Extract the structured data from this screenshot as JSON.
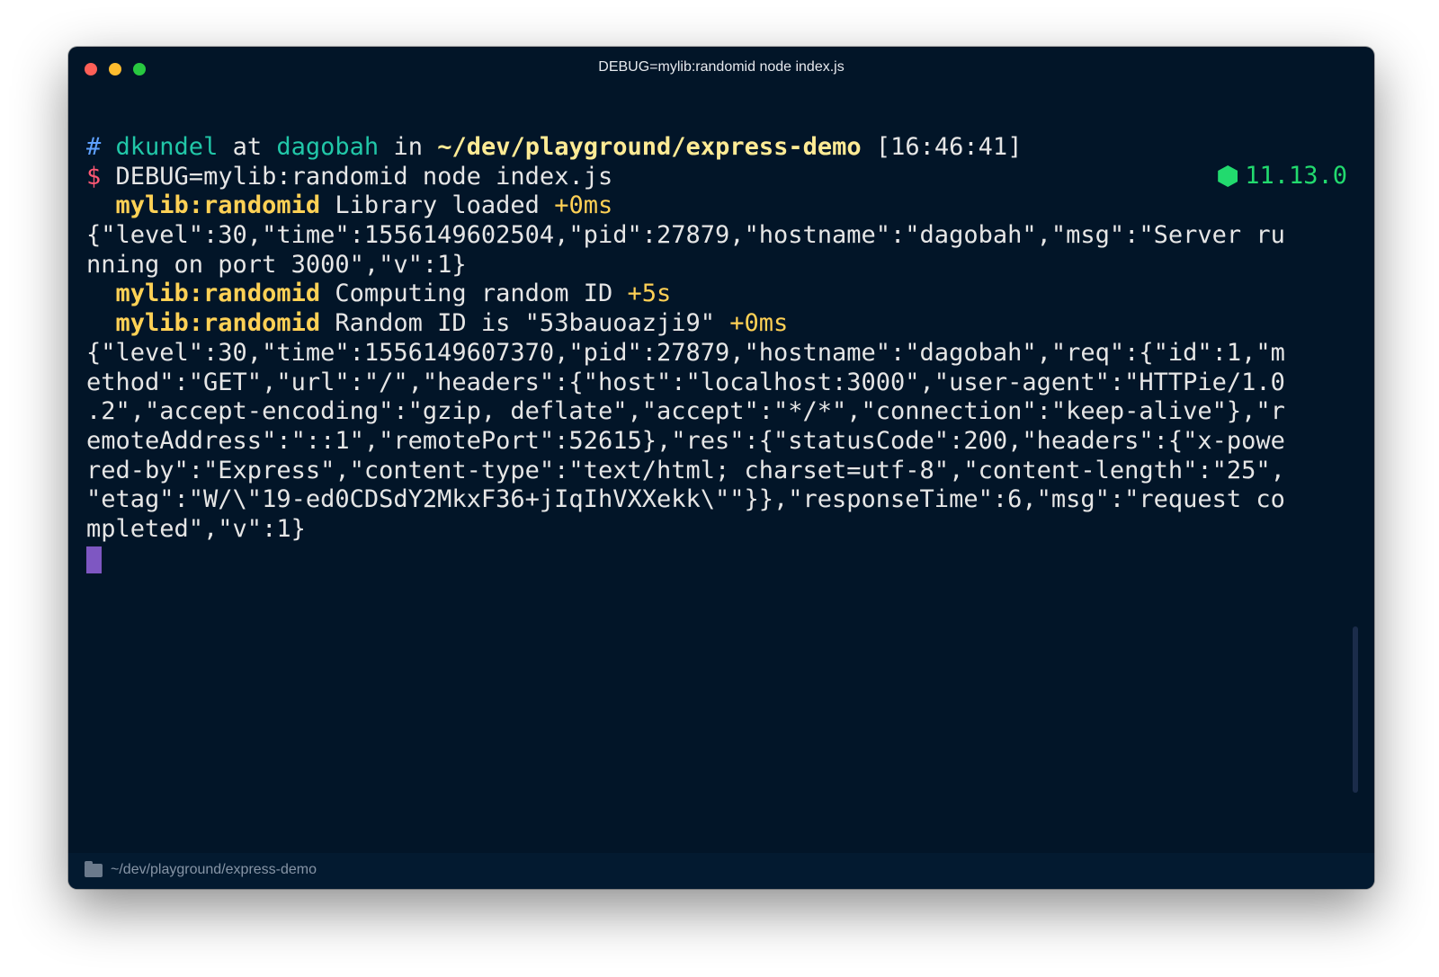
{
  "window": {
    "title": "DEBUG=mylib:randomid node index.js"
  },
  "prompt": {
    "hash": "#",
    "user": "dkundel",
    "at": "at",
    "host": "dagobah",
    "in": "in",
    "path": "~/dev/playground/express-demo",
    "time": "[16:46:41]",
    "dollar": "$",
    "command": "DEBUG=mylib:randomid node index.js",
    "node_version": "11.13.0"
  },
  "output": {
    "debug1": {
      "namespace": "mylib:randomid",
      "message": "Library loaded",
      "delta": "+0ms"
    },
    "log1": [
      "{\"level\":30,\"time\":1556149602504,\"pid\":27879,\"hostname\":\"dagobah\",\"msg\":\"Server ru",
      "nning on port 3000\",\"v\":1}"
    ],
    "debug2": {
      "namespace": "mylib:randomid",
      "message": "Computing random ID",
      "delta": "+5s"
    },
    "debug3": {
      "namespace": "mylib:randomid",
      "message": "Random ID is \"53bauoazji9\"",
      "delta": "+0ms"
    },
    "log2": [
      "{\"level\":30,\"time\":1556149607370,\"pid\":27879,\"hostname\":\"dagobah\",\"req\":{\"id\":1,\"m",
      "ethod\":\"GET\",\"url\":\"/\",\"headers\":{\"host\":\"localhost:3000\",\"user-agent\":\"HTTPie/1.0",
      ".2\",\"accept-encoding\":\"gzip, deflate\",\"accept\":\"*/*\",\"connection\":\"keep-alive\"},\"r",
      "emoteAddress\":\"::1\",\"remotePort\":52615},\"res\":{\"statusCode\":200,\"headers\":{\"x-powe",
      "red-by\":\"Express\",\"content-type\":\"text/html; charset=utf-8\",\"content-length\":\"25\",",
      "\"etag\":\"W/\\\"19-ed0CDSdY2MkxF36+jIqIhVXXekk\\\"\"}},\"responseTime\":6,\"msg\":\"request co",
      "mpleted\",\"v\":1}"
    ]
  },
  "statusbar": {
    "path": "~/dev/playground/express-demo"
  },
  "colors": {
    "background": "#021528",
    "hash": "#5ea1ff",
    "user_host": "#21c7a8",
    "path": "#ffeb95",
    "dollar": "#ff5874",
    "debug_namespace": "#ffd155",
    "node_version": "#22da6e",
    "cursor": "#7e57c2"
  }
}
